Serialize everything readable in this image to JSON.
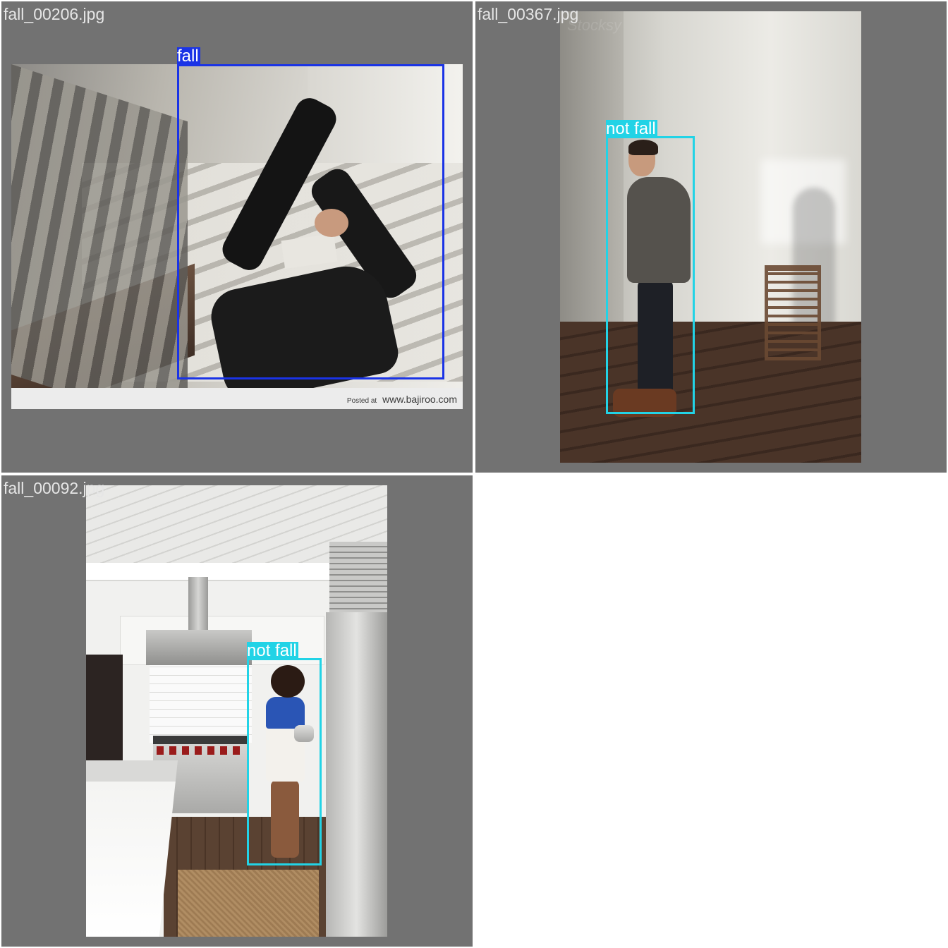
{
  "tiles": [
    {
      "filename": "fall_00206.jpg",
      "detection": {
        "label": "fall",
        "color": "#1a33e6"
      },
      "watermark": {
        "small": "Posted at",
        "site": "www.bajiroo.com"
      }
    },
    {
      "filename": "fall_00367.jpg",
      "detection": {
        "label": "not fall",
        "color": "#22d3e6"
      },
      "watermark_text": "Stocksy"
    },
    {
      "filename": "fall_00092.jpg",
      "detection": {
        "label": "not fall",
        "color": "#22d3e6"
      }
    }
  ],
  "colors": {
    "tile_background": "#727272",
    "page_background": "#ffffff",
    "filename_text": "#e6e6e6"
  }
}
